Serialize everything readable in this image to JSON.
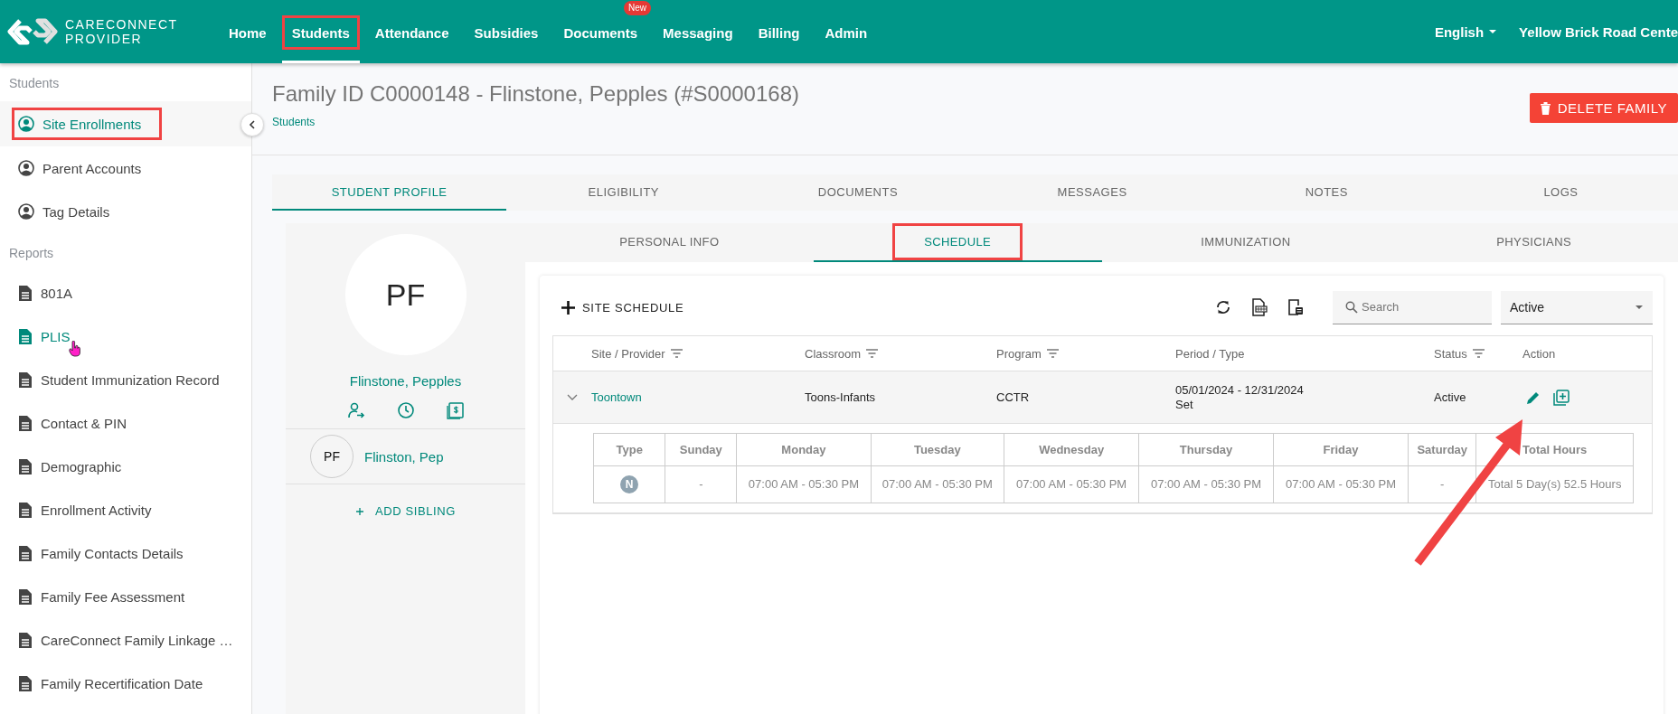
{
  "header": {
    "logo": {
      "line1": "CARECONNECT",
      "line2": "PROVIDER"
    },
    "nav": [
      {
        "label": "Home",
        "selected": false,
        "highlighted": false
      },
      {
        "label": "Students",
        "selected": true,
        "highlighted": true
      },
      {
        "label": "Attendance",
        "selected": false,
        "highlighted": false
      },
      {
        "label": "Subsidies",
        "selected": false,
        "highlighted": false
      },
      {
        "label": "Documents",
        "selected": false,
        "highlighted": false,
        "badge": "New"
      },
      {
        "label": "Messaging",
        "selected": false,
        "highlighted": false
      },
      {
        "label": "Billing",
        "selected": false,
        "highlighted": false
      },
      {
        "label": "Admin",
        "selected": false,
        "highlighted": false
      }
    ],
    "language": "English",
    "center": "Yellow Brick Road Cente"
  },
  "sidebar": {
    "sections": [
      {
        "title": "Students",
        "items": [
          {
            "label": "Site Enrollments",
            "kind": "person",
            "selected": true,
            "hovered": false,
            "highlighted": true
          },
          {
            "label": "Parent Accounts",
            "kind": "person",
            "selected": false,
            "hovered": false,
            "highlighted": false
          },
          {
            "label": "Tag Details",
            "kind": "person",
            "selected": false,
            "hovered": false,
            "highlighted": false
          }
        ]
      },
      {
        "title": "Reports",
        "items": [
          {
            "label": "801A",
            "kind": "report",
            "selected": false,
            "hovered": false,
            "highlighted": false
          },
          {
            "label": "PLIS",
            "kind": "report",
            "selected": false,
            "hovered": true,
            "highlighted": false
          },
          {
            "label": "Student Immunization Record",
            "kind": "report",
            "selected": false,
            "hovered": false,
            "highlighted": false
          },
          {
            "label": "Contact & PIN",
            "kind": "report",
            "selected": false,
            "hovered": false,
            "highlighted": false
          },
          {
            "label": "Demographic",
            "kind": "report",
            "selected": false,
            "hovered": false,
            "highlighted": false
          },
          {
            "label": "Enrollment Activity",
            "kind": "report",
            "selected": false,
            "hovered": false,
            "highlighted": false
          },
          {
            "label": "Family Contacts Details",
            "kind": "report",
            "selected": false,
            "hovered": false,
            "highlighted": false
          },
          {
            "label": "Family Fee Assessment",
            "kind": "report",
            "selected": false,
            "hovered": false,
            "highlighted": false
          },
          {
            "label": "CareConnect Family Linkage …",
            "kind": "report",
            "selected": false,
            "hovered": false,
            "highlighted": false
          },
          {
            "label": "Family Recertification Date",
            "kind": "report",
            "selected": false,
            "hovered": false,
            "highlighted": false
          }
        ]
      }
    ]
  },
  "page": {
    "title": "Family ID C0000148 - Flinstone, Pepples (#S0000168)",
    "breadcrumb": "Students",
    "delete_button": "DELETE FAMILY"
  },
  "tabs": [
    {
      "label": "STUDENT PROFILE",
      "selected": true
    },
    {
      "label": "ELIGIBILITY",
      "selected": false
    },
    {
      "label": "DOCUMENTS",
      "selected": false
    },
    {
      "label": "MESSAGES",
      "selected": false
    },
    {
      "label": "NOTES",
      "selected": false
    },
    {
      "label": "LOGS",
      "selected": false
    }
  ],
  "profile": {
    "initials": "PF",
    "name": "Flinstone, Pepples",
    "siblings": [
      {
        "initials": "PF",
        "name": "Flinston, Pep"
      }
    ],
    "add_sibling": "ADD SIBLING"
  },
  "subtabs": [
    {
      "label": "PERSONAL INFO",
      "selected": false,
      "highlighted": false
    },
    {
      "label": "SCHEDULE",
      "selected": true,
      "highlighted": true
    },
    {
      "label": "IMMUNIZATION",
      "selected": false,
      "highlighted": false
    },
    {
      "label": "PHYSICIANS",
      "selected": false,
      "highlighted": false
    }
  ],
  "schedule": {
    "add_button": "SITE SCHEDULE",
    "search": {
      "placeholder": "Search"
    },
    "status_filter": "Active",
    "columns": [
      {
        "label": "Site / Provider",
        "filter": true
      },
      {
        "label": "Classroom",
        "filter": true
      },
      {
        "label": "Program",
        "filter": true
      },
      {
        "label": "Period / Type",
        "filter": false
      },
      {
        "label": "Status",
        "filter": true
      },
      {
        "label": "Action",
        "filter": false
      }
    ],
    "rows": [
      {
        "expanded": true,
        "site": "Toontown",
        "classroom": "Toons-Infants",
        "program": "CCTR",
        "period": "05/01/2024 - 12/31/2024",
        "type": "Set",
        "status": "Active",
        "detail": {
          "columns": [
            "Type",
            "Sunday",
            "Monday",
            "Tuesday",
            "Wednesday",
            "Thursday",
            "Friday",
            "Saturday",
            "Total Hours"
          ],
          "rows": [
            {
              "cells": [
                "N",
                "-",
                "07:00 AM - 05:30 PM",
                "07:00 AM - 05:30 PM",
                "07:00 AM - 05:30 PM",
                "07:00 AM - 05:30 PM",
                "07:00 AM - 05:30 PM",
                "-",
                "Total 5 Day(s) 52.5 Hours"
              ]
            }
          ]
        }
      }
    ]
  }
}
